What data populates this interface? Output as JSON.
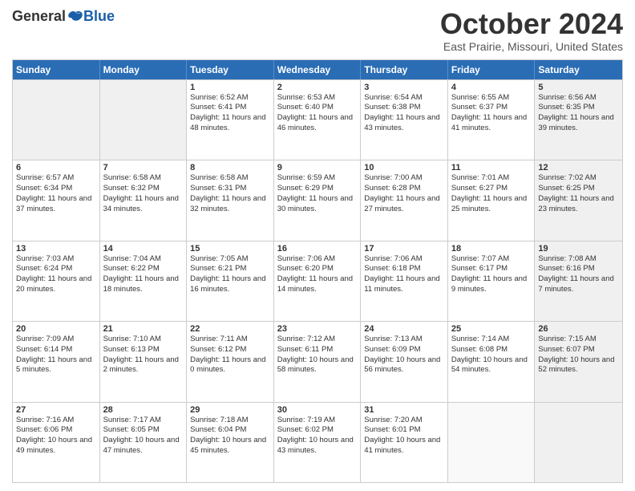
{
  "logo": {
    "general": "General",
    "blue": "Blue"
  },
  "title": "October 2024",
  "location": "East Prairie, Missouri, United States",
  "weekdays": [
    "Sunday",
    "Monday",
    "Tuesday",
    "Wednesday",
    "Thursday",
    "Friday",
    "Saturday"
  ],
  "weeks": [
    [
      {
        "day": "",
        "info": "",
        "shaded": true,
        "empty": true
      },
      {
        "day": "",
        "info": "",
        "shaded": true,
        "empty": true
      },
      {
        "day": "1",
        "info": "Sunrise: 6:52 AM\nSunset: 6:41 PM\nDaylight: 11 hours and 48 minutes."
      },
      {
        "day": "2",
        "info": "Sunrise: 6:53 AM\nSunset: 6:40 PM\nDaylight: 11 hours and 46 minutes."
      },
      {
        "day": "3",
        "info": "Sunrise: 6:54 AM\nSunset: 6:38 PM\nDaylight: 11 hours and 43 minutes."
      },
      {
        "day": "4",
        "info": "Sunrise: 6:55 AM\nSunset: 6:37 PM\nDaylight: 11 hours and 41 minutes."
      },
      {
        "day": "5",
        "info": "Sunrise: 6:56 AM\nSunset: 6:35 PM\nDaylight: 11 hours and 39 minutes.",
        "shaded": true
      }
    ],
    [
      {
        "day": "6",
        "info": "Sunrise: 6:57 AM\nSunset: 6:34 PM\nDaylight: 11 hours and 37 minutes."
      },
      {
        "day": "7",
        "info": "Sunrise: 6:58 AM\nSunset: 6:32 PM\nDaylight: 11 hours and 34 minutes."
      },
      {
        "day": "8",
        "info": "Sunrise: 6:58 AM\nSunset: 6:31 PM\nDaylight: 11 hours and 32 minutes."
      },
      {
        "day": "9",
        "info": "Sunrise: 6:59 AM\nSunset: 6:29 PM\nDaylight: 11 hours and 30 minutes."
      },
      {
        "day": "10",
        "info": "Sunrise: 7:00 AM\nSunset: 6:28 PM\nDaylight: 11 hours and 27 minutes."
      },
      {
        "day": "11",
        "info": "Sunrise: 7:01 AM\nSunset: 6:27 PM\nDaylight: 11 hours and 25 minutes."
      },
      {
        "day": "12",
        "info": "Sunrise: 7:02 AM\nSunset: 6:25 PM\nDaylight: 11 hours and 23 minutes.",
        "shaded": true
      }
    ],
    [
      {
        "day": "13",
        "info": "Sunrise: 7:03 AM\nSunset: 6:24 PM\nDaylight: 11 hours and 20 minutes."
      },
      {
        "day": "14",
        "info": "Sunrise: 7:04 AM\nSunset: 6:22 PM\nDaylight: 11 hours and 18 minutes."
      },
      {
        "day": "15",
        "info": "Sunrise: 7:05 AM\nSunset: 6:21 PM\nDaylight: 11 hours and 16 minutes."
      },
      {
        "day": "16",
        "info": "Sunrise: 7:06 AM\nSunset: 6:20 PM\nDaylight: 11 hours and 14 minutes."
      },
      {
        "day": "17",
        "info": "Sunrise: 7:06 AM\nSunset: 6:18 PM\nDaylight: 11 hours and 11 minutes."
      },
      {
        "day": "18",
        "info": "Sunrise: 7:07 AM\nSunset: 6:17 PM\nDaylight: 11 hours and 9 minutes."
      },
      {
        "day": "19",
        "info": "Sunrise: 7:08 AM\nSunset: 6:16 PM\nDaylight: 11 hours and 7 minutes.",
        "shaded": true
      }
    ],
    [
      {
        "day": "20",
        "info": "Sunrise: 7:09 AM\nSunset: 6:14 PM\nDaylight: 11 hours and 5 minutes."
      },
      {
        "day": "21",
        "info": "Sunrise: 7:10 AM\nSunset: 6:13 PM\nDaylight: 11 hours and 2 minutes."
      },
      {
        "day": "22",
        "info": "Sunrise: 7:11 AM\nSunset: 6:12 PM\nDaylight: 11 hours and 0 minutes."
      },
      {
        "day": "23",
        "info": "Sunrise: 7:12 AM\nSunset: 6:11 PM\nDaylight: 10 hours and 58 minutes."
      },
      {
        "day": "24",
        "info": "Sunrise: 7:13 AM\nSunset: 6:09 PM\nDaylight: 10 hours and 56 minutes."
      },
      {
        "day": "25",
        "info": "Sunrise: 7:14 AM\nSunset: 6:08 PM\nDaylight: 10 hours and 54 minutes."
      },
      {
        "day": "26",
        "info": "Sunrise: 7:15 AM\nSunset: 6:07 PM\nDaylight: 10 hours and 52 minutes.",
        "shaded": true
      }
    ],
    [
      {
        "day": "27",
        "info": "Sunrise: 7:16 AM\nSunset: 6:06 PM\nDaylight: 10 hours and 49 minutes."
      },
      {
        "day": "28",
        "info": "Sunrise: 7:17 AM\nSunset: 6:05 PM\nDaylight: 10 hours and 47 minutes."
      },
      {
        "day": "29",
        "info": "Sunrise: 7:18 AM\nSunset: 6:04 PM\nDaylight: 10 hours and 45 minutes."
      },
      {
        "day": "30",
        "info": "Sunrise: 7:19 AM\nSunset: 6:02 PM\nDaylight: 10 hours and 43 minutes."
      },
      {
        "day": "31",
        "info": "Sunrise: 7:20 AM\nSunset: 6:01 PM\nDaylight: 10 hours and 41 minutes."
      },
      {
        "day": "",
        "info": "",
        "empty": true
      },
      {
        "day": "",
        "info": "",
        "empty": true,
        "shaded": true
      }
    ]
  ]
}
